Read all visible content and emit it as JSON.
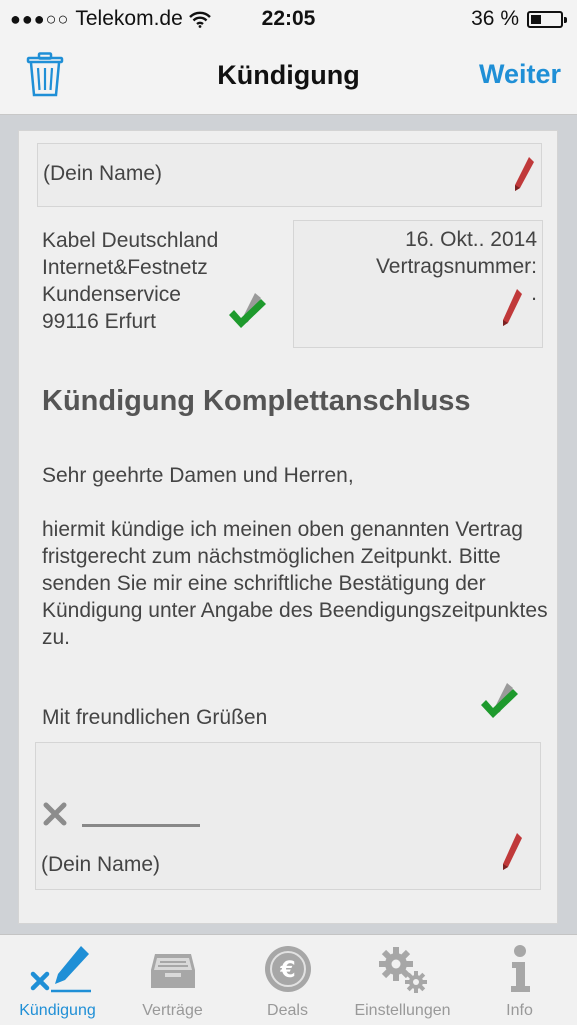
{
  "status": {
    "carrier": "Telekom.de",
    "time": "22:05",
    "battery": "36 %",
    "battery_level": 0.36
  },
  "nav": {
    "title": "Kündigung",
    "next": "Weiter"
  },
  "letter": {
    "sender_name": "(Dein Name)",
    "recipient": [
      "Kabel Deutschland",
      "Internet&Festnetz",
      "Kundenservice",
      "99116 Erfurt"
    ],
    "date": "16. Okt.. 2014",
    "contract_label": "Vertragsnummer:",
    "contract_value": ".",
    "subject": "Kündigung Komplettanschluss",
    "greeting": "Sehr geehrte Damen und Herren,",
    "body": "hiermit kündige ich meinen oben genannten Vertrag fristgerecht zum nächstmöglichen Zeitpunkt. Bitte senden Sie mir eine schriftliche Bestätigung  der Kündigung unter Angabe des Beendigungszeitpunktes zu.",
    "closing": "Mit freundlichen Grüßen",
    "signature_name": "(Dein Name)"
  },
  "tabs": [
    {
      "label": "Kündigung",
      "icon": "edit-icon"
    },
    {
      "label": "Verträge",
      "icon": "inbox-icon"
    },
    {
      "label": "Deals",
      "icon": "euro-coin-icon"
    },
    {
      "label": "Einstellungen",
      "icon": "gears-icon"
    },
    {
      "label": "Info",
      "icon": "info-icon"
    }
  ],
  "colors": {
    "accent": "#1f8fd6",
    "pencil": "#c0393a",
    "check": "#1e9a2d"
  }
}
